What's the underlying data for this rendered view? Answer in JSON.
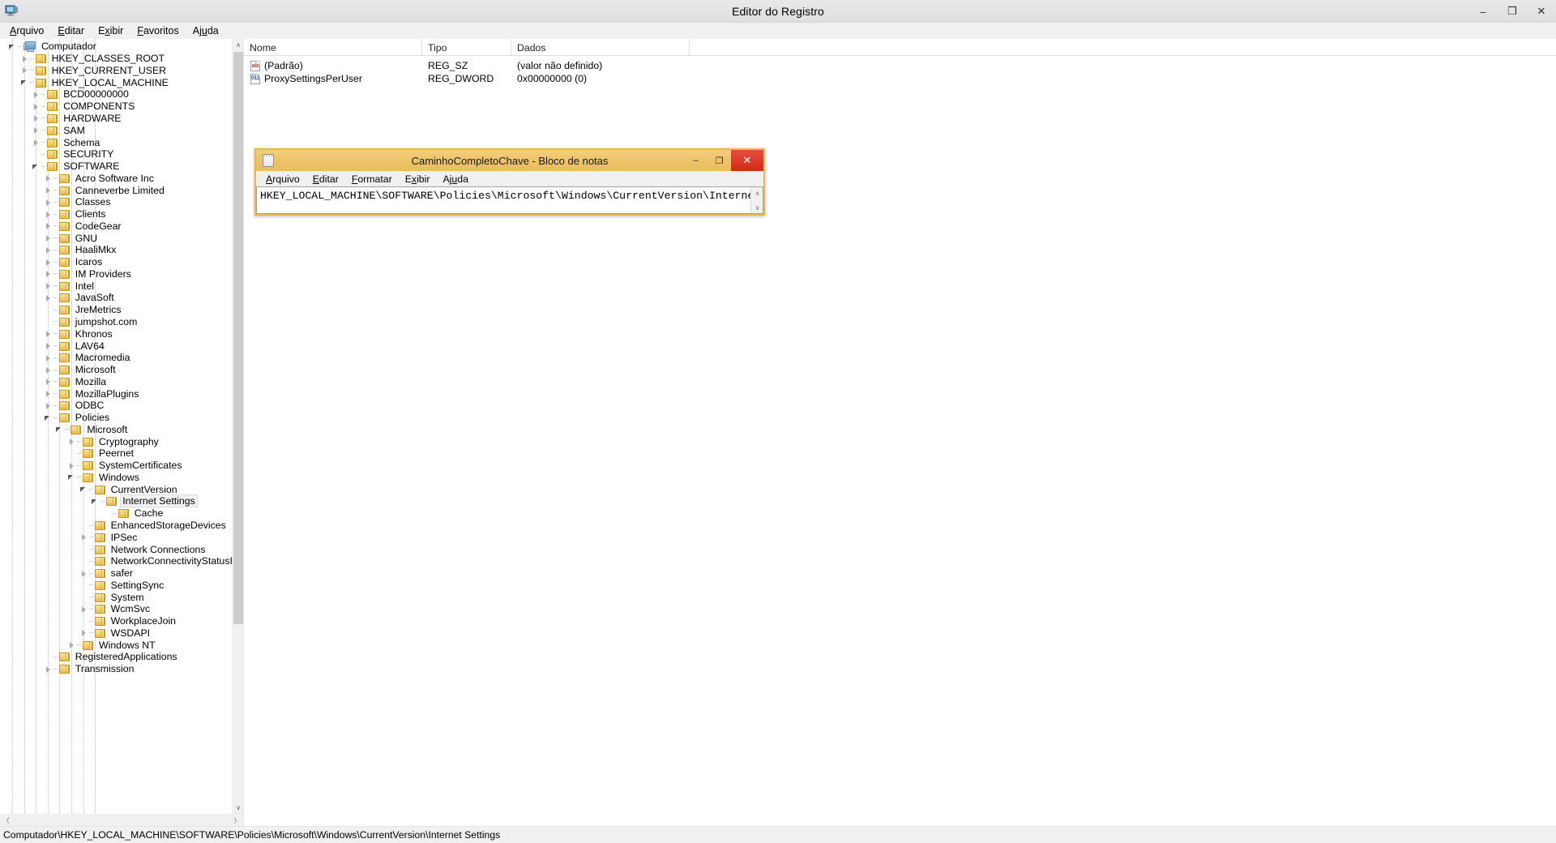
{
  "window": {
    "title": "Editor do Registro",
    "icon": "registry-editor-icon",
    "minimize_label": "–",
    "maximize_label": "❐",
    "close_label": "✕"
  },
  "menubar": [
    {
      "label": "Arquivo",
      "accel": "A"
    },
    {
      "label": "Editar",
      "accel": "E"
    },
    {
      "label": "Exibir",
      "accel": "x"
    },
    {
      "label": "Favoritos",
      "accel": "F"
    },
    {
      "label": "Ajuda",
      "accel": "u"
    }
  ],
  "tree": {
    "nodes": [
      {
        "label": "Computador",
        "depth": 0,
        "state": "expanded",
        "icon": "computer-icon"
      },
      {
        "label": "HKEY_CLASSES_ROOT",
        "depth": 1,
        "state": "collapsed",
        "icon": "folder-icon"
      },
      {
        "label": "HKEY_CURRENT_USER",
        "depth": 1,
        "state": "collapsed",
        "icon": "folder-icon"
      },
      {
        "label": "HKEY_LOCAL_MACHINE",
        "depth": 1,
        "state": "expanded",
        "icon": "folder-icon"
      },
      {
        "label": "BCD00000000",
        "depth": 2,
        "state": "collapsed",
        "icon": "folder-icon"
      },
      {
        "label": "COMPONENTS",
        "depth": 2,
        "state": "collapsed",
        "icon": "folder-icon"
      },
      {
        "label": "HARDWARE",
        "depth": 2,
        "state": "collapsed",
        "icon": "folder-icon"
      },
      {
        "label": "SAM",
        "depth": 2,
        "state": "collapsed",
        "icon": "folder-icon"
      },
      {
        "label": "Schema",
        "depth": 2,
        "state": "collapsed",
        "icon": "folder-icon"
      },
      {
        "label": "SECURITY",
        "depth": 2,
        "state": "leaf",
        "icon": "folder-icon"
      },
      {
        "label": "SOFTWARE",
        "depth": 2,
        "state": "expanded",
        "icon": "folder-icon"
      },
      {
        "label": "Acro Software Inc",
        "depth": 3,
        "state": "collapsed",
        "icon": "folder-icon"
      },
      {
        "label": "Canneverbe Limited",
        "depth": 3,
        "state": "collapsed",
        "icon": "folder-icon"
      },
      {
        "label": "Classes",
        "depth": 3,
        "state": "collapsed",
        "icon": "folder-icon"
      },
      {
        "label": "Clients",
        "depth": 3,
        "state": "collapsed",
        "icon": "folder-icon"
      },
      {
        "label": "CodeGear",
        "depth": 3,
        "state": "collapsed",
        "icon": "folder-icon"
      },
      {
        "label": "GNU",
        "depth": 3,
        "state": "collapsed",
        "icon": "folder-icon"
      },
      {
        "label": "HaaliMkx",
        "depth": 3,
        "state": "collapsed",
        "icon": "folder-icon"
      },
      {
        "label": "Icaros",
        "depth": 3,
        "state": "collapsed",
        "icon": "folder-icon"
      },
      {
        "label": "IM Providers",
        "depth": 3,
        "state": "collapsed",
        "icon": "folder-icon"
      },
      {
        "label": "Intel",
        "depth": 3,
        "state": "collapsed",
        "icon": "folder-icon"
      },
      {
        "label": "JavaSoft",
        "depth": 3,
        "state": "collapsed",
        "icon": "folder-icon"
      },
      {
        "label": "JreMetrics",
        "depth": 3,
        "state": "leaf",
        "icon": "folder-icon"
      },
      {
        "label": "jumpshot.com",
        "depth": 3,
        "state": "leaf",
        "icon": "folder-icon"
      },
      {
        "label": "Khronos",
        "depth": 3,
        "state": "collapsed",
        "icon": "folder-icon"
      },
      {
        "label": "LAV64",
        "depth": 3,
        "state": "collapsed",
        "icon": "folder-icon"
      },
      {
        "label": "Macromedia",
        "depth": 3,
        "state": "collapsed",
        "icon": "folder-icon"
      },
      {
        "label": "Microsoft",
        "depth": 3,
        "state": "collapsed",
        "icon": "folder-icon"
      },
      {
        "label": "Mozilla",
        "depth": 3,
        "state": "collapsed",
        "icon": "folder-icon"
      },
      {
        "label": "MozillaPlugins",
        "depth": 3,
        "state": "collapsed",
        "icon": "folder-icon"
      },
      {
        "label": "ODBC",
        "depth": 3,
        "state": "collapsed",
        "icon": "folder-icon"
      },
      {
        "label": "Policies",
        "depth": 3,
        "state": "expanded",
        "icon": "folder-icon"
      },
      {
        "label": "Microsoft",
        "depth": 4,
        "state": "expanded",
        "icon": "folder-icon"
      },
      {
        "label": "Cryptography",
        "depth": 5,
        "state": "collapsed",
        "icon": "folder-icon"
      },
      {
        "label": "Peernet",
        "depth": 5,
        "state": "leaf",
        "icon": "folder-icon"
      },
      {
        "label": "SystemCertificates",
        "depth": 5,
        "state": "collapsed",
        "icon": "folder-icon"
      },
      {
        "label": "Windows",
        "depth": 5,
        "state": "expanded",
        "icon": "folder-icon"
      },
      {
        "label": "CurrentVersion",
        "depth": 6,
        "state": "expanded",
        "icon": "folder-icon"
      },
      {
        "label": "Internet Settings",
        "depth": 7,
        "state": "expanded",
        "icon": "folder-icon",
        "selected": true
      },
      {
        "label": "Cache",
        "depth": 8,
        "state": "leaf",
        "icon": "folder-icon"
      },
      {
        "label": "EnhancedStorageDevices",
        "depth": 6,
        "state": "leaf",
        "icon": "folder-icon"
      },
      {
        "label": "IPSec",
        "depth": 6,
        "state": "collapsed",
        "icon": "folder-icon"
      },
      {
        "label": "Network Connections",
        "depth": 6,
        "state": "leaf",
        "icon": "folder-icon"
      },
      {
        "label": "NetworkConnectivityStatusIndicato",
        "depth": 6,
        "state": "leaf",
        "icon": "folder-icon"
      },
      {
        "label": "safer",
        "depth": 6,
        "state": "collapsed",
        "icon": "folder-icon"
      },
      {
        "label": "SettingSync",
        "depth": 6,
        "state": "leaf",
        "icon": "folder-icon"
      },
      {
        "label": "System",
        "depth": 6,
        "state": "leaf",
        "icon": "folder-icon"
      },
      {
        "label": "WcmSvc",
        "depth": 6,
        "state": "collapsed",
        "icon": "folder-icon"
      },
      {
        "label": "WorkplaceJoin",
        "depth": 6,
        "state": "leaf",
        "icon": "folder-icon"
      },
      {
        "label": "WSDAPI",
        "depth": 6,
        "state": "collapsed",
        "icon": "folder-icon"
      },
      {
        "label": "Windows NT",
        "depth": 5,
        "state": "collapsed",
        "icon": "folder-icon"
      },
      {
        "label": "RegisteredApplications",
        "depth": 3,
        "state": "leaf",
        "icon": "folder-icon"
      },
      {
        "label": "Transmission",
        "depth": 3,
        "state": "collapsed",
        "icon": "folder-icon"
      }
    ],
    "scroll_up_arrow": "∧",
    "scroll_down_arrow": "∨",
    "scroll_left_arrow": "〈",
    "scroll_right_arrow": "〉"
  },
  "list": {
    "columns": [
      "Nome",
      "Tipo",
      "Dados"
    ],
    "rows": [
      {
        "icon": "string-value-icon",
        "icon_text": "ab",
        "name": "(Padrão)",
        "type": "REG_SZ",
        "data": "(valor não definido)"
      },
      {
        "icon": "dword-value-icon",
        "icon_text": "011",
        "name": "ProxySettingsPerUser",
        "type": "REG_DWORD",
        "data": "0x00000000 (0)"
      }
    ]
  },
  "statusbar": {
    "path": "Computador\\HKEY_LOCAL_MACHINE\\SOFTWARE\\Policies\\Microsoft\\Windows\\CurrentVersion\\Internet Settings"
  },
  "notepad": {
    "title": "CaminhoCompletoChave - Bloco de notas",
    "icon": "notepad-icon",
    "minimize_label": "–",
    "maximize_label": "❐",
    "close_label": "✕",
    "menus": [
      {
        "label": "Arquivo",
        "accel": "A"
      },
      {
        "label": "Editar",
        "accel": "E"
      },
      {
        "label": "Formatar",
        "accel": "F"
      },
      {
        "label": "Exibir",
        "accel": "x"
      },
      {
        "label": "Ajuda",
        "accel": "u"
      }
    ],
    "content": "HKEY_LOCAL_MACHINE\\SOFTWARE\\Policies\\Microsoft\\Windows\\CurrentVersion\\Internet Settings",
    "scroll_up_arrow": "∧",
    "scroll_down_arrow": "∨"
  },
  "colors": {
    "notepad_titlebar": "#eec46c",
    "notepad_border": "#e8b84b",
    "close_button_red": "#cf2b1a",
    "folder_yellow": "#f6d277",
    "selection_bg": "#f2f2f2"
  }
}
